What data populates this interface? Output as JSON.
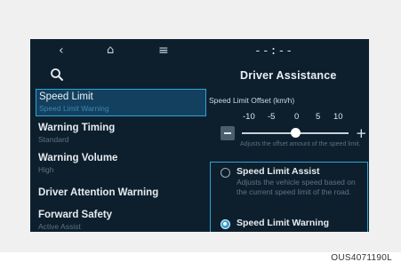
{
  "topbar": {
    "back_icon": "‹",
    "home_icon": "⌂",
    "menu_icon": "≡",
    "clock": "--:--"
  },
  "page": {
    "title": "Driver Assistance"
  },
  "menu": {
    "items": [
      {
        "label": "Speed Limit",
        "sub": "Speed Limit Warning"
      },
      {
        "label": "Warning Timing",
        "sub": "Standard"
      },
      {
        "label": "Warning Volume",
        "sub": "High"
      },
      {
        "label": "Driver Attention Warning",
        "sub": ""
      },
      {
        "label": "Forward Safety",
        "sub": "Active Assist"
      }
    ]
  },
  "offset": {
    "label": "Speed Limit Offset (km/h)",
    "ticks": [
      "-10",
      "-5",
      "0",
      "5",
      "10"
    ],
    "value": 0,
    "help": "Adjusts the offset amount of the speed limit."
  },
  "assist": {
    "option1_label": "Speed Limit Assist",
    "option1_desc": "Adjusts the vehicle speed based on the current speed limit of the road.",
    "option2_label": "Speed Limit Warning",
    "selected": "Speed Limit Warning"
  },
  "caption": "OUS4071190L",
  "colors": {
    "screen_bg": "#0d1f2d",
    "accent": "#2fa4d6",
    "selected_bg": "#13405e"
  }
}
